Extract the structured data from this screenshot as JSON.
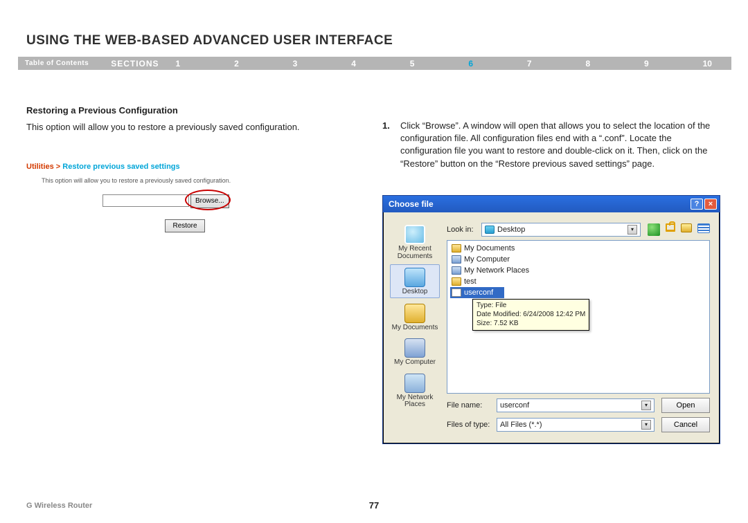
{
  "title": "USING THE WEB-BASED ADVANCED USER INTERFACE",
  "nav": {
    "toc_label": "Table of Contents",
    "sections_label": "SECTIONS",
    "numbers": [
      "1",
      "2",
      "3",
      "4",
      "5",
      "6",
      "7",
      "8",
      "9",
      "10"
    ],
    "active_index": 5
  },
  "subheading": "Restoring a Previous Configuration",
  "intro_text": "This option will allow you to restore a previously saved configuration.",
  "breadcrumb": {
    "utilities": "Utilities > ",
    "rest": "Restore previous saved settings"
  },
  "mini": {
    "caption": "This option will allow you to restore a previously saved configuration.",
    "input_value": "",
    "browse_label": "Browse...",
    "restore_label": "Restore"
  },
  "step": {
    "number": "1.",
    "text": "Click “Browse”. A window will open that allows you to select the location of the configuration file. All configuration files end with a “.conf”. Locate the configuration file you want to restore and double-click on it. Then, click on the “Restore” button on the “Restore previous saved settings” page."
  },
  "dialog": {
    "title": "Choose file",
    "help_glyph": "?",
    "close_glyph": "×",
    "lookin_label": "Look in:",
    "lookin_value": "Desktop",
    "dd_glyph": "▾",
    "places": {
      "recent": "My Recent Documents",
      "desktop": "Desktop",
      "mydocs": "My Documents",
      "mycomp": "My Computer",
      "mynet": "My Network Places"
    },
    "files": {
      "i0": "My Documents",
      "i1": "My Computer",
      "i2": "My Network Places",
      "i3": "test",
      "i4": "userconf"
    },
    "tooltip": {
      "l1": "Type: File",
      "l2": "Date Modified: 6/24/2008 12:42 PM",
      "l3": "Size: 7.52 KB"
    },
    "file_name_label": "File name:",
    "file_name_value": "userconf",
    "file_type_label": "Files of type:",
    "file_type_value": "All Files (*.*)",
    "open_label": "Open",
    "cancel_label": "Cancel"
  },
  "footer": {
    "left": "G Wireless Router",
    "page": "77"
  }
}
